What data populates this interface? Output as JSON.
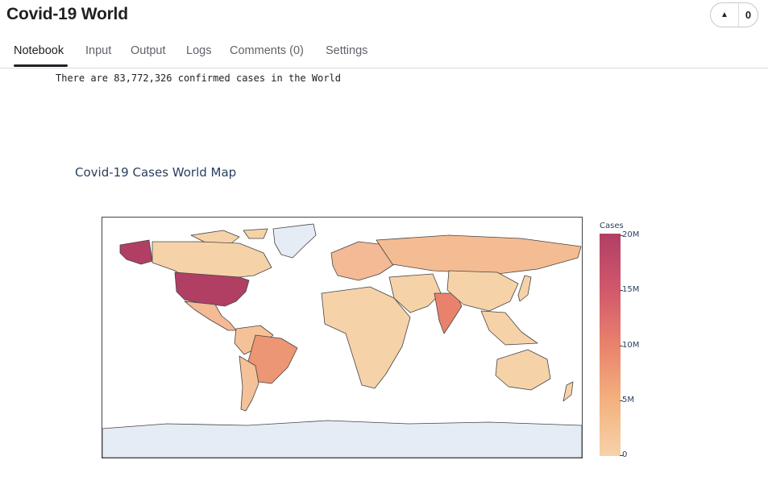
{
  "header": {
    "title": "Covid-19 World",
    "vote_count": "0"
  },
  "tabs": [
    {
      "label": "Notebook",
      "active": true
    },
    {
      "label": "Input",
      "active": false
    },
    {
      "label": "Output",
      "active": false
    },
    {
      "label": "Logs",
      "active": false
    },
    {
      "label": "Comments (0)",
      "active": false
    },
    {
      "label": "Settings",
      "active": false
    }
  ],
  "output": {
    "text": "There are 83,772,326 confirmed cases in the World"
  },
  "map": {
    "title": "Covid-19 Cases World Map",
    "legend_title": "Cases",
    "ticks": [
      "20M",
      "15M",
      "10M",
      "5M",
      "0"
    ],
    "colors": {
      "low": "#f6d2a9",
      "mid": "#e9826c",
      "high": "#b13f64",
      "land_none": "#e5ecf6",
      "border": "#444444"
    }
  }
}
